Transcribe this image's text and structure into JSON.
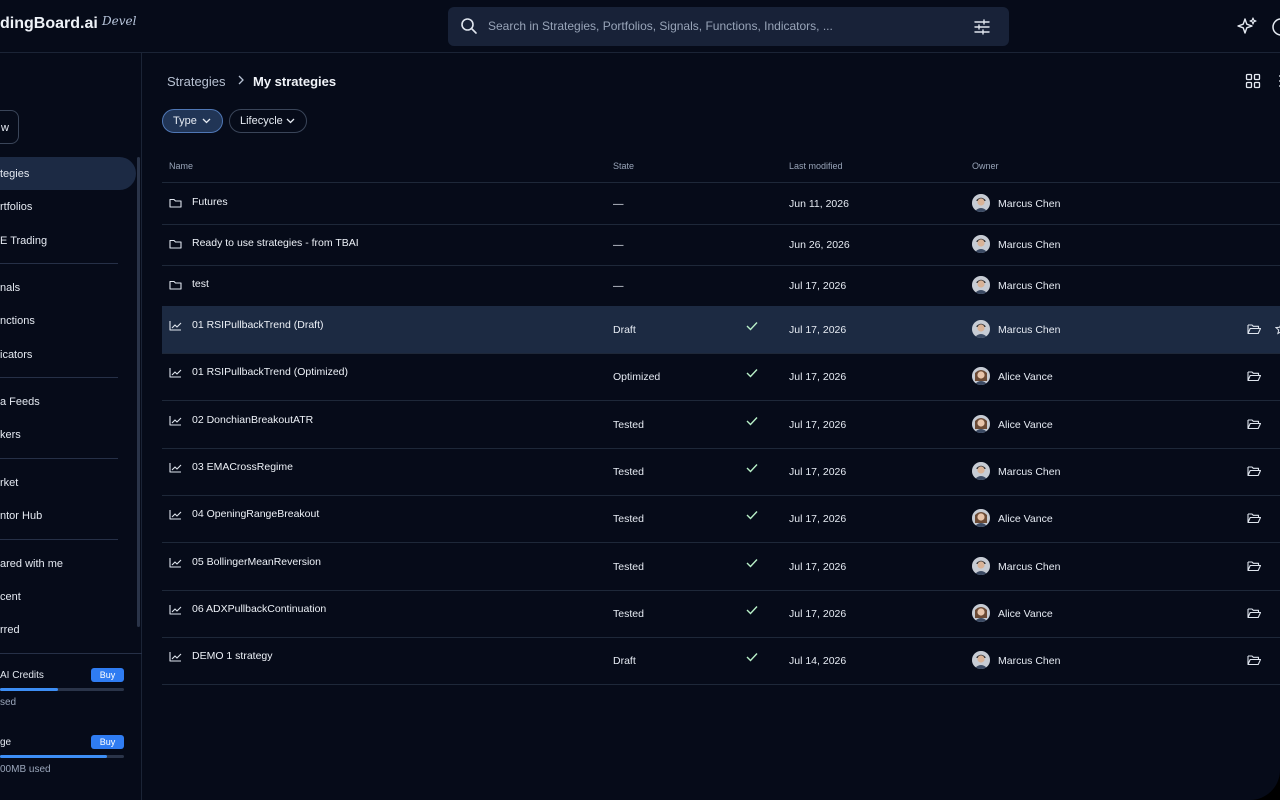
{
  "app": {
    "brand": "dingBoard.ai",
    "env": "Devel"
  },
  "search": {
    "placeholder": "Search in Strategies, Portfolios, Signals, Functions, Indicators, ..."
  },
  "sidebar": {
    "new_label": "w",
    "items": [
      {
        "label": "tegies",
        "active": true
      },
      {
        "label": "rtfolios"
      },
      {
        "label": "E Trading"
      },
      {
        "label": "nals"
      },
      {
        "label": "nctions"
      },
      {
        "label": "icators"
      },
      {
        "label": "a Feeds"
      },
      {
        "label": "kers"
      },
      {
        "label": "rket"
      },
      {
        "label": "ntor Hub"
      },
      {
        "label": "ared with me"
      },
      {
        "label": "cent"
      },
      {
        "label": "rred"
      }
    ],
    "credits": {
      "label": "AI Credits",
      "buy": "Buy",
      "sub": "sed",
      "fill": 0.47
    },
    "storage": {
      "label": "ge",
      "buy": "Buy",
      "sub": "00MB used",
      "fill": 0.86
    }
  },
  "breadcrumb": {
    "root": "Strategies",
    "current": "My strategies"
  },
  "filters": {
    "type": "Type",
    "lifecycle": "Lifecycle"
  },
  "table": {
    "headers": {
      "name": "Name",
      "state": "State",
      "modified": "Last modified",
      "owner": "Owner"
    },
    "rows": [
      {
        "kind": "folder",
        "name": "Futures",
        "state": "—",
        "date": "Jun 11, 2026",
        "owner": "Marcus Chen"
      },
      {
        "kind": "folder",
        "name": "Ready to use strategies - from TBAI",
        "state": "—",
        "date": "Jun 26, 2026",
        "owner": "Marcus Chen"
      },
      {
        "kind": "folder",
        "name": "test",
        "state": "—",
        "date": "Jul 17, 2026",
        "owner": "Marcus Chen"
      },
      {
        "kind": "strategy",
        "name": "01 RSIPullbackTrend (Draft)",
        "state": "Draft",
        "date": "Jul 17, 2026",
        "owner": "Marcus Chen",
        "selected": true
      },
      {
        "kind": "strategy",
        "name": "01 RSIPullbackTrend (Optimized)",
        "state": "Optimized",
        "date": "Jul 17, 2026",
        "owner": "Alice Vance"
      },
      {
        "kind": "strategy",
        "name": "02 DonchianBreakoutATR",
        "state": "Tested",
        "date": "Jul 17, 2026",
        "owner": "Alice Vance"
      },
      {
        "kind": "strategy",
        "name": "03 EMACrossRegime",
        "state": "Tested",
        "date": "Jul 17, 2026",
        "owner": "Marcus Chen"
      },
      {
        "kind": "strategy",
        "name": "04 OpeningRangeBreakout",
        "state": "Tested",
        "date": "Jul 17, 2026",
        "owner": "Alice Vance"
      },
      {
        "kind": "strategy",
        "name": "05 BollingerMeanReversion",
        "state": "Tested",
        "date": "Jul 17, 2026",
        "owner": "Marcus Chen"
      },
      {
        "kind": "strategy",
        "name": "06 ADXPullbackContinuation",
        "state": "Tested",
        "date": "Jul 17, 2026",
        "owner": "Alice Vance"
      },
      {
        "kind": "strategy",
        "name": "DEMO 1 strategy",
        "state": "Draft",
        "date": "Jul 14, 2026",
        "owner": "Marcus Chen"
      }
    ]
  },
  "colors": {
    "background": "#060b19",
    "accent": "#2f7cf2",
    "selected_row": "#1c2a42",
    "check": "#b8f0c8"
  }
}
